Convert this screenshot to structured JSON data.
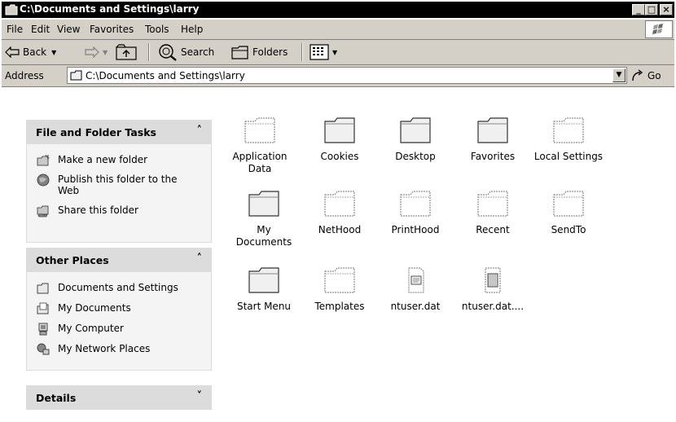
{
  "window": {
    "title": "C:\\Documents and Settings\\larry"
  },
  "menu": [
    "File",
    "Edit",
    "View",
    "Favorites",
    "Tools",
    "Help"
  ],
  "toolbar": {
    "back": "Back",
    "search": "Search",
    "folders": "Folders"
  },
  "address": {
    "label": "Address",
    "value": "C:\\Documents and Settings\\larry",
    "go": "Go"
  },
  "tasks_panel": {
    "title": "File and Folder Tasks",
    "items": [
      "Make a new folder",
      "Publish this folder to the Web",
      "Share this folder"
    ]
  },
  "places_panel": {
    "title": "Other Places",
    "items": [
      "Documents and Settings",
      "My Documents",
      "My Computer",
      "My Network Places"
    ]
  },
  "details_panel": {
    "title": "Details"
  },
  "items": [
    {
      "label": "Application Data",
      "icon": "folder-hidden-icon"
    },
    {
      "label": "Cookies",
      "icon": "folder-icon"
    },
    {
      "label": "Desktop",
      "icon": "folder-icon"
    },
    {
      "label": "Favorites",
      "icon": "folder-icon"
    },
    {
      "label": "Local Settings",
      "icon": "folder-hidden-icon"
    },
    {
      "label": "My Documents",
      "icon": "folder-icon"
    },
    {
      "label": "NetHood",
      "icon": "folder-hidden-icon"
    },
    {
      "label": "PrintHood",
      "icon": "folder-hidden-icon"
    },
    {
      "label": "Recent",
      "icon": "folder-hidden-icon"
    },
    {
      "label": "SendTo",
      "icon": "folder-hidden-icon"
    },
    {
      "label": "Start Menu",
      "icon": "folder-icon"
    },
    {
      "label": "Templates",
      "icon": "folder-hidden-icon"
    },
    {
      "label": "ntuser.dat",
      "icon": "dat-file-icon"
    },
    {
      "label": "ntuser.dat....",
      "icon": "log-file-icon"
    }
  ]
}
